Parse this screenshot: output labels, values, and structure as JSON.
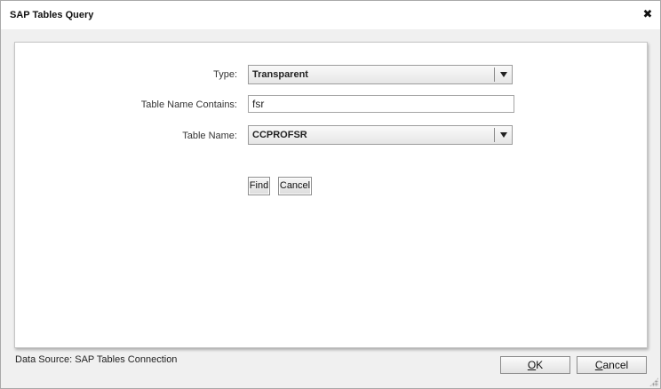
{
  "window": {
    "title": "SAP Tables Query",
    "close_glyph": "✖"
  },
  "form": {
    "type_label": "Type:",
    "type_value": "Transparent",
    "contains_label": "Table Name Contains:",
    "contains_value": "fsr",
    "name_label": "Table Name:",
    "name_value": "CCPROFSR",
    "find_label": "Find",
    "cancel_label": "Cancel"
  },
  "footer": {
    "data_source": "Data Source: SAP Tables Connection",
    "ok_mnemonic": "O",
    "ok_rest": "K",
    "cancel_mnemonic": "C",
    "cancel_rest": "ancel"
  }
}
